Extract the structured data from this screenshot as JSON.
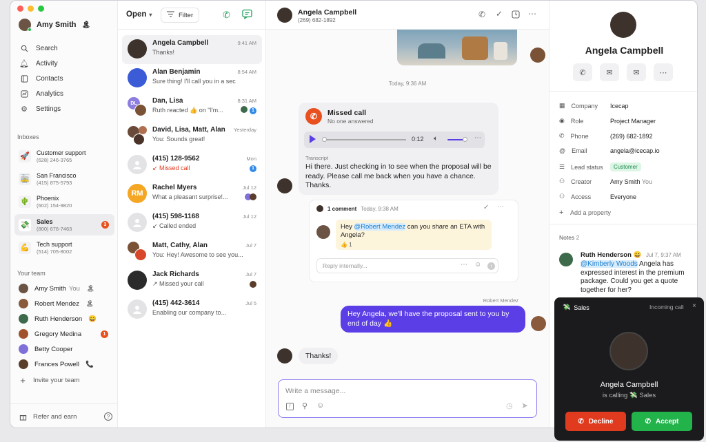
{
  "sidebar": {
    "user_name": "Amy Smith",
    "nav": [
      "Search",
      "Activity",
      "Contacts",
      "Analytics",
      "Settings"
    ],
    "inboxes_title": "Inboxes",
    "inboxes": [
      {
        "name": "Customer support",
        "phone": "(628) 246-3765",
        "emoji": "🚀"
      },
      {
        "name": "San Francisco",
        "phone": "(415) 875-5793",
        "emoji": "🚋"
      },
      {
        "name": "Phoenix",
        "phone": "(602) 154-9820",
        "emoji": "🌵"
      },
      {
        "name": "Sales",
        "phone": "(800) 676-7463",
        "emoji": "💸",
        "badge": "3"
      },
      {
        "name": "Tech support",
        "phone": "(514) 705-8002",
        "emoji": "💪"
      }
    ],
    "team_title": "Your team",
    "team": [
      {
        "name": "Amy Smith",
        "suffix": "You",
        "emoji": "🏝"
      },
      {
        "name": "Robert Mendez",
        "emoji": "🏝"
      },
      {
        "name": "Ruth Henderson",
        "emoji": "😄"
      },
      {
        "name": "Gregory Medina",
        "badge": "1"
      },
      {
        "name": "Betty Cooper"
      },
      {
        "name": "Frances Powell",
        "emoji": "📞"
      }
    ],
    "invite": "Invite your team",
    "refer": "Refer and earn"
  },
  "list": {
    "filter_status": "Open",
    "filter_label": "Filter",
    "items": [
      {
        "name": "Angela Campbell",
        "time": "9:41 AM",
        "preview": "Thanks!",
        "selected": true
      },
      {
        "name": "Alan Benjamin",
        "time": "8:54 AM",
        "preview": "Sure thing! I'll call you in a sec"
      },
      {
        "name": "Dan, Lisa",
        "time": "8:31 AM",
        "preview": "Ruth reacted 👍 on \"I'm...",
        "badge": "1"
      },
      {
        "name": "David, Lisa, Matt, Alan",
        "time": "Yesterday",
        "preview": "Sounds great!",
        "prefix": "You: "
      },
      {
        "name": "(415) 128-9562",
        "time": "Mon",
        "preview": "Missed call",
        "missed": true,
        "badge": "1"
      },
      {
        "name": "Rachel Myers",
        "time": "Jul 12",
        "preview": "What a pleasant surprise!...",
        "initials": "RM"
      },
      {
        "name": "(415) 598-1168",
        "time": "Jul 12",
        "preview": "Called ended"
      },
      {
        "name": "Matt, Cathy, Alan",
        "time": "Jul 7",
        "preview": "You: Hey! Awesome to see you..."
      },
      {
        "name": "Jack Richards",
        "time": "Jul 7",
        "preview": "Missed your call"
      },
      {
        "name": "(415) 442-3614",
        "time": "Jul 5",
        "preview": "Enabling our company to..."
      }
    ]
  },
  "chat": {
    "contact_name": "Angela Campbell",
    "contact_phone": "(269) 682-1892",
    "day_label": "Today, 9:36 AM",
    "missed_title": "Missed call",
    "missed_sub": "No one answered",
    "audio_time": "0:12",
    "transcript_label": "Transcript",
    "transcript": "Hi there. Just checking in to see when the proposal will be ready. Please call me back when you have a chance. Thanks.",
    "comment_count": "1 comment",
    "comment_time": "Today, 9:38 AM",
    "comment_pre": "Hey ",
    "comment_mention": "@Robert Mendez",
    "comment_post": " can you share an ETA with Angela?",
    "comment_reaction": "👍 1",
    "reply_placeholder": "Reply internally...",
    "sender_label": "Robert Mendez",
    "outgoing": "Hey Angela, we'll have the proposal sent to you by end of day 👍",
    "incoming": "Thanks!",
    "composer_placeholder": "Write a message..."
  },
  "contact": {
    "name": "Angela Campbell",
    "props": [
      {
        "key": "Company",
        "value": "Icecap",
        "icon": "▦"
      },
      {
        "key": "Role",
        "value": "Project Manager",
        "icon": "◉"
      },
      {
        "key": "Phone",
        "value": "(269) 682-1892",
        "icon": "✆"
      },
      {
        "key": "Email",
        "value": "angela@icecap.io",
        "icon": "@"
      },
      {
        "key": "Lead status",
        "value": "Customer",
        "icon": "☰",
        "tag": true
      },
      {
        "key": "Creator",
        "value": "Amy Smith",
        "suffix": "You",
        "icon": "⚇"
      },
      {
        "key": "Access",
        "value": "Everyone",
        "icon": "⚇"
      }
    ],
    "add_property": "Add a property",
    "notes_label": "Notes",
    "notes_count": "2",
    "note_author": "Ruth Henderson 😄",
    "note_time": "Jul 7, 9:37 AM",
    "note_mention": "@Kimberly Woods",
    "note_text": " Angela has expressed interest in the premium package. Could you get a quote together for her?"
  },
  "call": {
    "inbox": "Sales",
    "status": "Incoming call",
    "caller": "Angela Campbell",
    "calling_prefix": "is calling",
    "calling_inbox": "💸 Sales",
    "decline": "Decline",
    "accept": "Accept"
  },
  "colors": {
    "accent": "#5b3ee6",
    "decline": "#e03a1f",
    "accept": "#22b34b",
    "missed": "#e8501f"
  }
}
